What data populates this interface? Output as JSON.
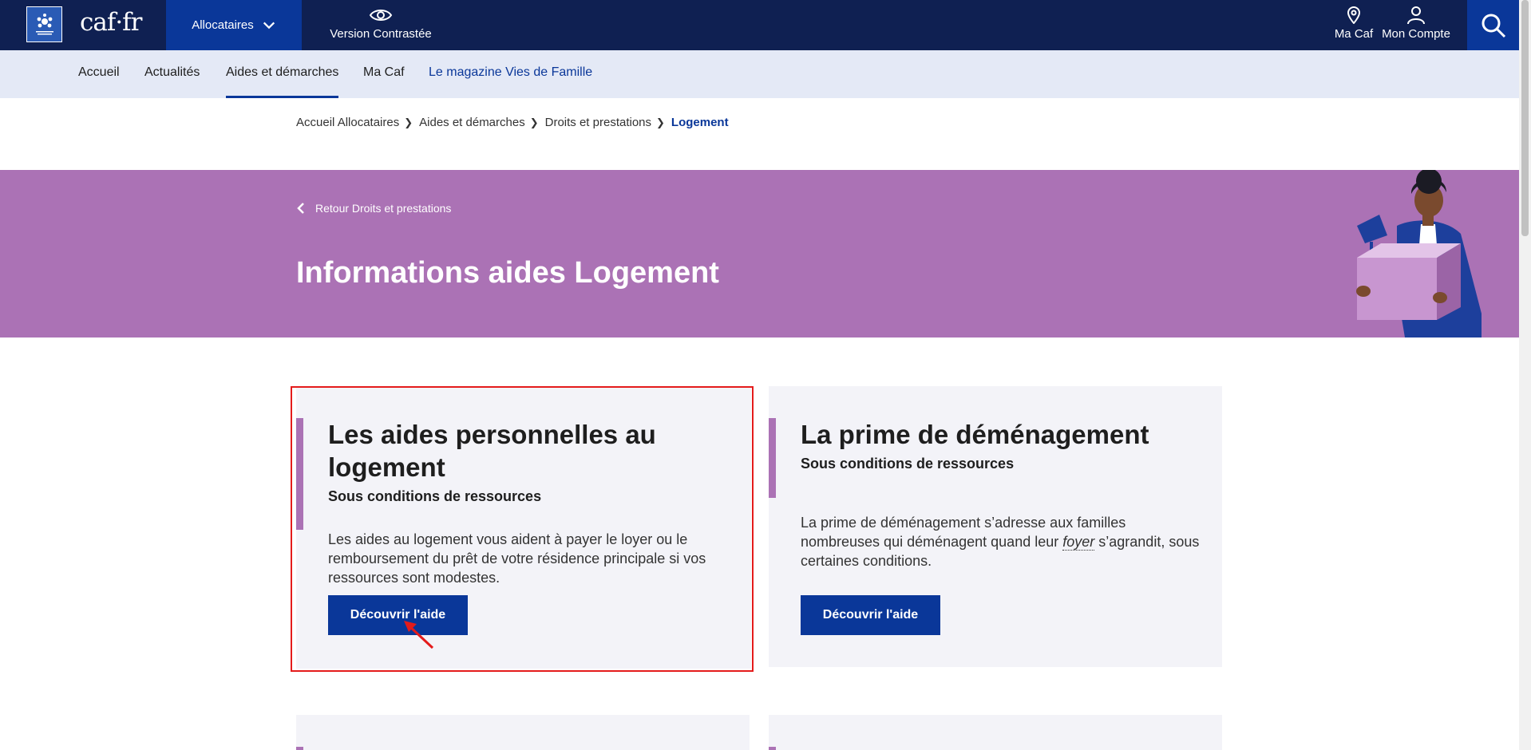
{
  "header": {
    "logo_text": "caf·fr",
    "logo_badge": "ALLOCATIONS FAMILIALES",
    "audience_tab": "Allocataires",
    "contrast_label": "Version Contrastée",
    "ma_caf_label": "Ma Caf",
    "account_label": "Mon Compte"
  },
  "subnav": {
    "items": [
      {
        "label": "Accueil"
      },
      {
        "label": "Actualités"
      },
      {
        "label": "Aides et démarches"
      },
      {
        "label": "Ma Caf"
      },
      {
        "label": "Le magazine Vies de Famille"
      }
    ]
  },
  "breadcrumb": {
    "items": [
      "Accueil Allocataires",
      "Aides et démarches",
      "Droits et prestations",
      "Logement"
    ]
  },
  "hero": {
    "back_label": "Retour Droits et prestations",
    "title": "Informations aides Logement"
  },
  "cards": [
    {
      "title": "Les aides personnelles au logement",
      "subtitle": "Sous conditions de ressources",
      "description": "Les aides au logement vous aident à payer le loyer ou le remboursement du prêt de votre résidence principale si vos ressources sont modestes.",
      "button": "Découvrir l'aide"
    },
    {
      "title": "La prime de déménagement",
      "subtitle": "Sous conditions de ressources",
      "description_before": "La prime de déménagement s’adresse aux familles nombreuses qui déménagent quand leur ",
      "description_term": "foyer",
      "description_after": " s’agrandit, sous certaines conditions.",
      "button": "Découvrir l'aide"
    }
  ],
  "colors": {
    "navy": "#0f2052",
    "primary_blue": "#0a3799",
    "purple": "#ab72b5",
    "subnav_bg": "#e4e9f6",
    "card_bg": "#f3f3f8",
    "highlight_red": "#e41b1b"
  }
}
